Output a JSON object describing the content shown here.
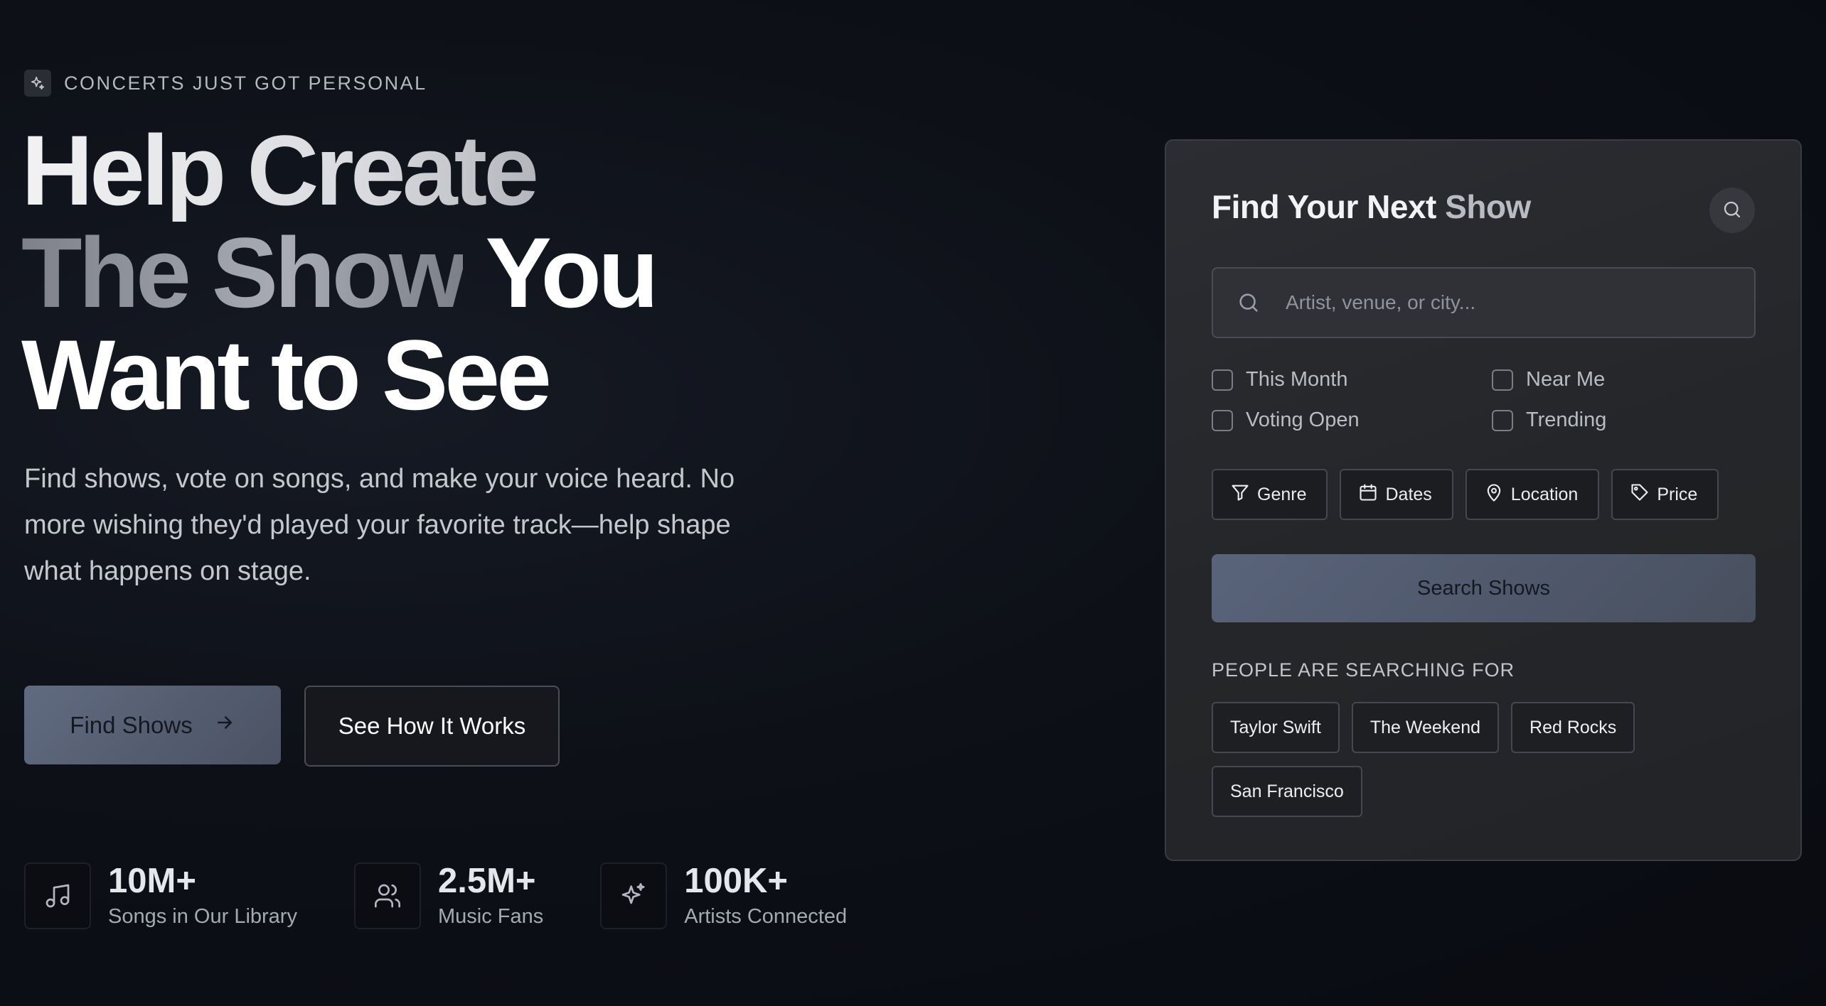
{
  "hero": {
    "eyebrow": "CONCERTS JUST GOT PERSONAL",
    "headline": {
      "line1": "Help Create",
      "line2_dim": "The Show",
      "line2_bright": "You",
      "line3": "Want to See"
    },
    "subtitle": "Find shows, vote on songs, and make your voice heard. No more wishing they'd played your favorite track—help shape what happens on stage.",
    "primary_button": "Find Shows",
    "secondary_button": "See How It Works"
  },
  "stats": [
    {
      "icon": "music-note-icon",
      "value": "10M+",
      "label": "Songs in Our Library"
    },
    {
      "icon": "users-icon",
      "value": "2.5M+",
      "label": "Music Fans"
    },
    {
      "icon": "sparkles-icon",
      "value": "100K+",
      "label": "Artists Connected"
    }
  ],
  "search_card": {
    "title_main": "Find Your Next",
    "title_accent": "Show",
    "search_placeholder": "Artist, venue, or city...",
    "checkboxes": [
      {
        "label": "This Month",
        "checked": false
      },
      {
        "label": "Near Me",
        "checked": false
      },
      {
        "label": "Voting Open",
        "checked": false
      },
      {
        "label": "Trending",
        "checked": false
      }
    ],
    "filters": [
      {
        "label": "Genre",
        "icon": "filter-icon"
      },
      {
        "label": "Dates",
        "icon": "calendar-icon"
      },
      {
        "label": "Location",
        "icon": "map-pin-icon"
      },
      {
        "label": "Price",
        "icon": "tag-icon"
      }
    ],
    "submit_button": "Search Shows",
    "popular_title": "PEOPLE ARE SEARCHING FOR",
    "popular_chips": [
      "Taylor Swift",
      "The Weekend",
      "Red Rocks",
      "San Francisco"
    ]
  },
  "colors": {
    "background": "#0b0d13",
    "card": "#26282c",
    "primary_button": "#565f73",
    "text_primary": "#ffffff",
    "text_muted": "#a5a9b1"
  }
}
